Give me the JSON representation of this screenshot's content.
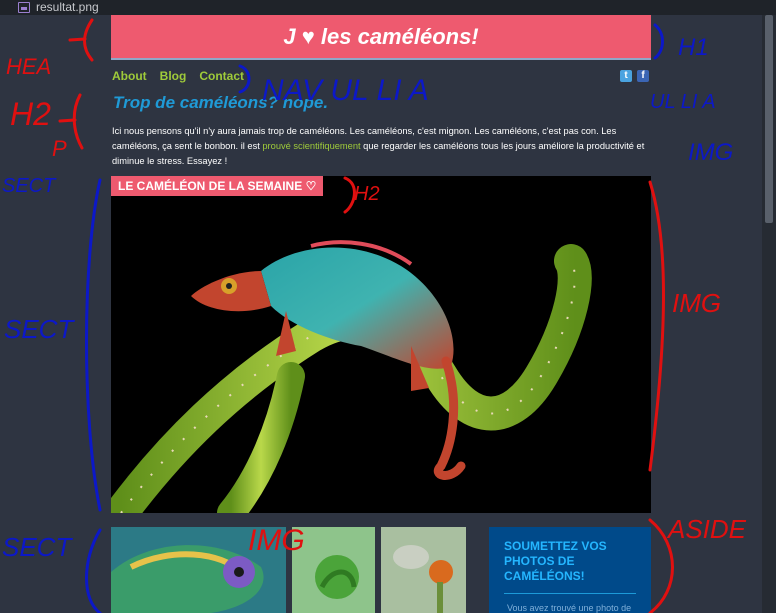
{
  "tab": {
    "title": "resultat.png"
  },
  "header": {
    "title": "J ♥ les caméléons!"
  },
  "nav": {
    "about": "About",
    "blog": "Blog",
    "contact": "Contact"
  },
  "social": {
    "twitter_icon": "twitter-icon",
    "facebook_icon": "facebook-icon"
  },
  "main": {
    "subtitle": "Trop de caméléons? nope.",
    "intro_before": "Ici nous pensons qu'il n'y aura jamais trop de caméléons. Les caméléons, c'est mignon. Les caméléons, c'est pas con. Les caméléons, ça sent le bonbon. il est ",
    "intro_link": "prouvé scientifiquement",
    "intro_after": " que regarder les caméléons tous les jours améliore la productivité et diminue le stress. Essayez !"
  },
  "hero": {
    "badge": "LE CAMÉLÉON DE LA SEMAINE ♡"
  },
  "aside": {
    "title": "SOUMETTEZ VOS PHOTOS DE CAMÉLÉONS!",
    "text": "Vous avez trouvé une photo de"
  },
  "annotations": {
    "header_label": "HEA",
    "h1_label": "H1",
    "nav_label": "NAV UL LI A",
    "h2_label": "H2",
    "p_label": "P",
    "sect_label": "SECT",
    "right_labels": "UL LI A",
    "img_label": "IMG",
    "h2_hero_label": "H2",
    "img_hero_label": "IMG",
    "sect_hero_label": "SECT",
    "sect_bottom_label": "SECT",
    "img_bottom_label": "IMG",
    "aside_label": "ASIDE"
  },
  "colors": {
    "accent": "#ee5a6f",
    "nav": "#9fcb3a",
    "subtitle": "#1f9ad6",
    "aside": "#004a8a"
  }
}
